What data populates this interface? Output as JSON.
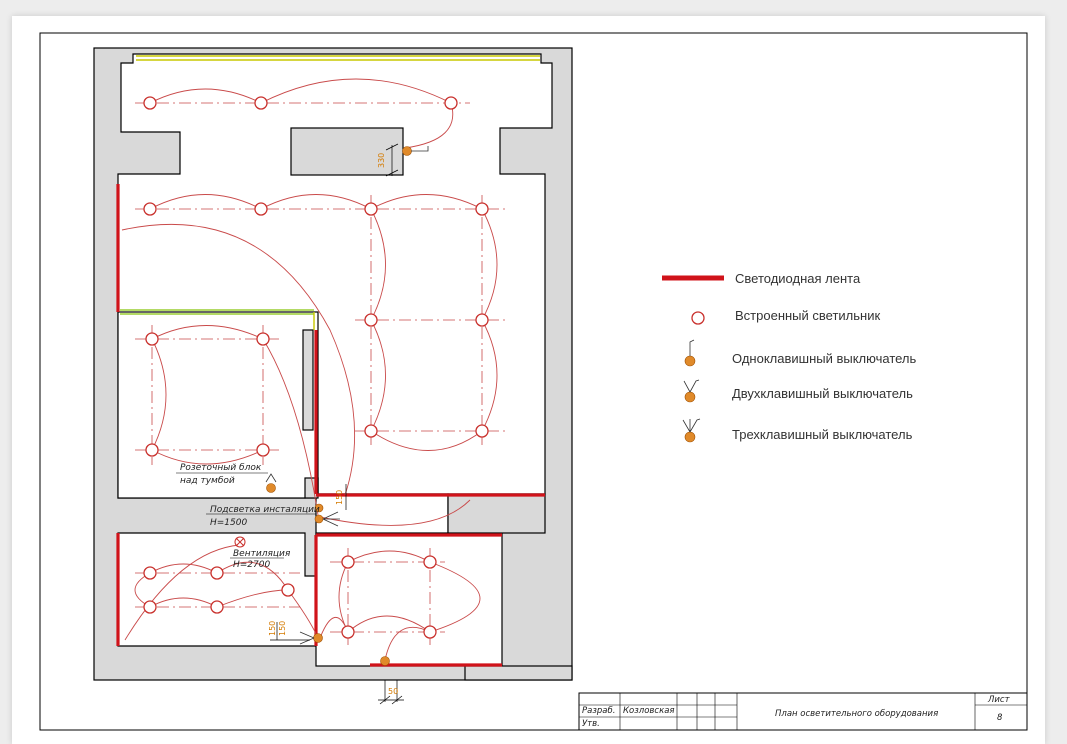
{
  "legend": {
    "led_strip": "Светодиодная лента",
    "recessed_light": "Встроенный светильник",
    "switch_single": "Одноклавишный выключатель",
    "switch_double": "Двухклавишный выключатель",
    "switch_triple": "Трехклавишный выключатель"
  },
  "annotations": {
    "socket_line1": "Розеточный блок",
    "socket_line2": "над тумбой",
    "install_line1": "Подсветка инсталяции",
    "install_line2": "Н=1500",
    "vent_line1": "Вентиляция",
    "vent_line2": "Н=2700"
  },
  "dimensions": {
    "d330": "330",
    "d150a": "150",
    "d150b": "150",
    "d150c": "150",
    "d50": "50"
  },
  "title_block": {
    "developed_label": "Разраб.",
    "developer_name": "Козловская",
    "approved_label": "Утв.",
    "title": "План осветительного оборудования",
    "sheet_label": "Лист",
    "sheet_number": "8"
  },
  "colors": {
    "led_strip": "#d0131a",
    "light_fixture": "#c9302c",
    "switch": "#e08a2a",
    "wall_fill": "#d9d9d9"
  }
}
